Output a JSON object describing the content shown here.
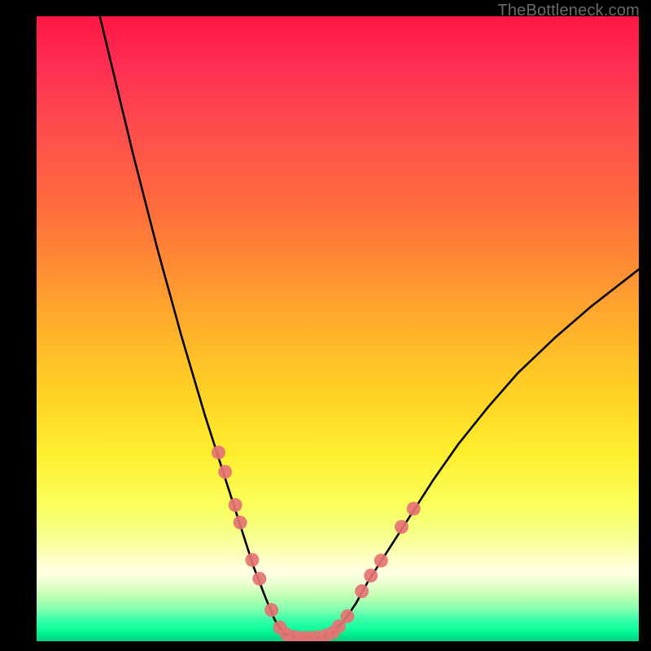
{
  "watermark": "TheBottleneck.com",
  "chart_data": {
    "type": "line",
    "title": "",
    "xlabel": "",
    "ylabel": "",
    "xlim": [
      0,
      100
    ],
    "ylim": [
      0,
      100
    ],
    "grid": false,
    "legend": false,
    "series": [
      {
        "name": "left-curve",
        "color": "#000000",
        "x": [
          10.5,
          12,
          14,
          16,
          18,
          20,
          22,
          24,
          26,
          28,
          30,
          32,
          34,
          36,
          38,
          39.5,
          41
        ],
        "y": [
          100,
          94,
          86,
          78,
          70.5,
          63,
          56,
          49,
          42.5,
          36,
          30,
          24,
          18,
          12,
          7,
          3.5,
          1.2
        ]
      },
      {
        "name": "valley-floor",
        "color": "#000000",
        "x": [
          41,
          43,
          45,
          47,
          49
        ],
        "y": [
          1.2,
          0.6,
          0.5,
          0.6,
          1.2
        ]
      },
      {
        "name": "right-curve",
        "color": "#000000",
        "x": [
          49,
          51,
          53,
          55,
          58,
          62,
          66,
          70,
          75,
          80,
          86,
          92,
          98,
          100
        ],
        "y": [
          1.2,
          3.2,
          6,
          9.5,
          14,
          20,
          26,
          31.5,
          37.5,
          43,
          48.5,
          53.5,
          58,
          59.5
        ]
      }
    ],
    "markers": {
      "name": "data-points",
      "color": "#e57373",
      "radius_px": 8.5,
      "points": [
        {
          "x": 30.2,
          "y": 30.2
        },
        {
          "x": 31.3,
          "y": 27.1
        },
        {
          "x": 33.0,
          "y": 21.8
        },
        {
          "x": 33.8,
          "y": 19.0
        },
        {
          "x": 35.8,
          "y": 13.0
        },
        {
          "x": 37.0,
          "y": 10.0
        },
        {
          "x": 39.0,
          "y": 5.0
        },
        {
          "x": 40.4,
          "y": 2.2
        },
        {
          "x": 41.5,
          "y": 1.1
        },
        {
          "x": 42.8,
          "y": 0.7
        },
        {
          "x": 44.0,
          "y": 0.55
        },
        {
          "x": 45.2,
          "y": 0.55
        },
        {
          "x": 46.5,
          "y": 0.65
        },
        {
          "x": 48.0,
          "y": 0.9
        },
        {
          "x": 49.2,
          "y": 1.4
        },
        {
          "x": 50.2,
          "y": 2.4
        },
        {
          "x": 51.6,
          "y": 4.0
        },
        {
          "x": 54.0,
          "y": 8.0
        },
        {
          "x": 55.5,
          "y": 10.5
        },
        {
          "x": 57.2,
          "y": 12.9
        },
        {
          "x": 60.6,
          "y": 18.3
        },
        {
          "x": 62.6,
          "y": 21.2
        }
      ]
    }
  }
}
